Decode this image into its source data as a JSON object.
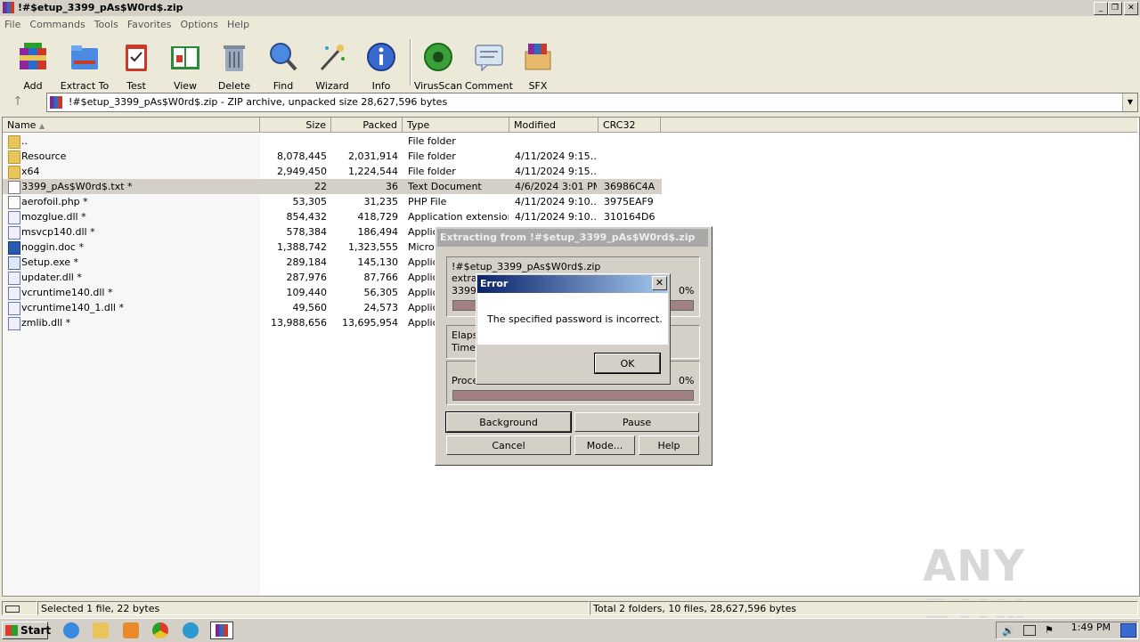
{
  "window": {
    "title": "!#$etup_3399_pAs$W0rd$.zip"
  },
  "menu": [
    "File",
    "Commands",
    "Tools",
    "Favorites",
    "Options",
    "Help"
  ],
  "toolbar": [
    {
      "label": "Add",
      "icon": "add-archive-icon"
    },
    {
      "label": "Extract To",
      "icon": "extract-folder-icon"
    },
    {
      "label": "Test",
      "icon": "test-clipboard-icon"
    },
    {
      "label": "View",
      "icon": "view-book-icon"
    },
    {
      "label": "Delete",
      "icon": "trash-icon"
    },
    {
      "label": "Find",
      "icon": "magnifier-icon"
    },
    {
      "label": "Wizard",
      "icon": "wand-icon"
    },
    {
      "label": "Info",
      "icon": "info-icon"
    },
    {
      "label": "VirusScan",
      "icon": "virus-icon"
    },
    {
      "label": "Comment",
      "icon": "comment-icon"
    },
    {
      "label": "SFX",
      "icon": "sfx-box-icon"
    }
  ],
  "address": {
    "text": "!#$etup_3399_pAs$W0rd$.zip - ZIP archive, unpacked size 28,627,596 bytes"
  },
  "columns": {
    "name": "Name",
    "size": "Size",
    "packed": "Packed",
    "type": "Type",
    "modified": "Modified",
    "crc": "CRC32"
  },
  "files": [
    {
      "name": "..",
      "size": "",
      "packed": "",
      "type": "File folder",
      "modified": "",
      "crc": "",
      "icon": "folder"
    },
    {
      "name": "Resource",
      "size": "8,078,445",
      "packed": "2,031,914",
      "type": "File folder",
      "modified": "4/11/2024 9:15…",
      "crc": "",
      "icon": "folder"
    },
    {
      "name": "x64",
      "size": "2,949,450",
      "packed": "1,224,544",
      "type": "File folder",
      "modified": "4/11/2024 9:15…",
      "crc": "",
      "icon": "folder"
    },
    {
      "name": "3399_pAs$W0rd$.txt *",
      "size": "22",
      "packed": "36",
      "type": "Text Document",
      "modified": "4/6/2024 3:01 PM",
      "crc": "36986C4A",
      "icon": "doc",
      "selected": true
    },
    {
      "name": "aerofoil.php *",
      "size": "53,305",
      "packed": "31,235",
      "type": "PHP File",
      "modified": "4/11/2024 9:10…",
      "crc": "3975EAF9",
      "icon": "doc"
    },
    {
      "name": "mozglue.dll *",
      "size": "854,432",
      "packed": "418,729",
      "type": "Application extension",
      "modified": "4/11/2024 9:10…",
      "crc": "310164D6",
      "icon": "dll"
    },
    {
      "name": "msvcp140.dll *",
      "size": "578,384",
      "packed": "186,494",
      "type": "Applic",
      "modified": "",
      "crc": "",
      "icon": "dll"
    },
    {
      "name": "noggin.doc *",
      "size": "1,388,742",
      "packed": "1,323,555",
      "type": "Micros",
      "modified": "",
      "crc": "",
      "icon": "word"
    },
    {
      "name": "Setup.exe *",
      "size": "289,184",
      "packed": "145,130",
      "type": "Applic",
      "modified": "",
      "crc": "",
      "icon": "exe"
    },
    {
      "name": "updater.dll *",
      "size": "287,976",
      "packed": "87,766",
      "type": "Applic",
      "modified": "",
      "crc": "",
      "icon": "dll"
    },
    {
      "name": "vcruntime140.dll *",
      "size": "109,440",
      "packed": "56,305",
      "type": "Applic",
      "modified": "",
      "crc": "",
      "icon": "dll"
    },
    {
      "name": "vcruntime140_1.dll *",
      "size": "49,560",
      "packed": "24,573",
      "type": "Applic",
      "modified": "",
      "crc": "",
      "icon": "dll"
    },
    {
      "name": "zmlib.dll *",
      "size": "13,988,656",
      "packed": "13,695,954",
      "type": "Applic",
      "modified": "",
      "crc": "",
      "icon": "dll"
    }
  ],
  "extract_dialog": {
    "title": "Extracting from !#$etup_3399_pAs$W0rd$.zip",
    "archive": "!#$etup_3399_pAs$W0rd$.zip",
    "line2": "extra",
    "line3": "3399_",
    "pct1": "0%",
    "progress1": 0,
    "elapsed": "Elapse",
    "time_left": "Time l",
    "processed": "Proce",
    "pct2": "0%",
    "progress2": 0,
    "buttons": {
      "background": "Background",
      "pause": "Pause",
      "cancel": "Cancel",
      "mode": "Mode...",
      "help": "Help"
    }
  },
  "error_dialog": {
    "title": "Error",
    "message": "The specified password is incorrect.",
    "ok": "OK",
    "close": "✕"
  },
  "status": {
    "left": "Selected 1 file, 22 bytes",
    "right": "Total 2 folders, 10 files, 28,627,596 bytes"
  },
  "taskbar": {
    "start": "Start",
    "clock": "1:49 PM"
  },
  "watermark": "ANY RUN"
}
